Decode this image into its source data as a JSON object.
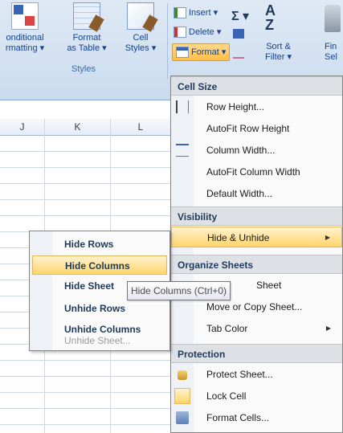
{
  "ribbon": {
    "styles_group": {
      "label": "Styles",
      "conditional_formatting": {
        "line1": "onditional",
        "line2": "rmatting ▾",
        "icon": "conditional-formatting-icon"
      },
      "format_as_table": {
        "line1": "Format",
        "line2": "as Table ▾",
        "icon": "format-as-table-icon"
      },
      "cell_styles": {
        "line1": "Cell",
        "line2": "Styles ▾",
        "icon": "cell-styles-icon"
      }
    },
    "cells_group": {
      "insert": "Insert ▾",
      "delete": "Delete ▾",
      "format": "Format ▾"
    },
    "editing_group": {
      "sigma": "Σ ▾",
      "sort_filter": {
        "line1": "Sort &",
        "line2": "Filter ▾"
      },
      "find_select": {
        "line1": "Fin",
        "line2": "Sel"
      }
    }
  },
  "sheet": {
    "column_headers": [
      "J",
      "K",
      "L"
    ]
  },
  "format_menu": {
    "sections": {
      "cell_size": "Cell Size",
      "visibility": "Visibility",
      "organize_sheets": "Organize Sheets",
      "protection": "Protection"
    },
    "items": {
      "row_height": "Row Height...",
      "autofit_row_height": "AutoFit Row Height",
      "column_width": "Column Width...",
      "autofit_column_width": "AutoFit Column Width",
      "default_width": "Default Width...",
      "hide_unhide": "Hide & Unhide",
      "rename_sheet": "Sheet",
      "move_copy_sheet": "Move or Copy Sheet...",
      "tab_color": "Tab Color",
      "protect_sheet": "Protect Sheet...",
      "lock_cell": "Lock Cell",
      "format_cells": "Format Cells..."
    }
  },
  "hide_unhide_submenu": {
    "items": [
      {
        "label": "Hide Rows",
        "highlighted": false,
        "enabled": true
      },
      {
        "label": "Hide Columns",
        "highlighted": true,
        "enabled": true
      },
      {
        "label": "Hide Sheet",
        "highlighted": false,
        "enabled": true
      },
      {
        "label": "Unhide Rows",
        "highlighted": false,
        "enabled": true
      },
      {
        "label": "Unhide Columns",
        "highlighted": false,
        "enabled": true
      },
      {
        "label": "Unhide Sheet...",
        "highlighted": false,
        "enabled": false
      }
    ]
  },
  "tooltip": {
    "text": "Hide Columns (Ctrl+0)"
  },
  "colors": {
    "ribbon_bg": "#d3e1f1",
    "highlight": "#ffd56b",
    "menu_header_bg": "#dde1e6",
    "text_blue": "#1e395b"
  }
}
